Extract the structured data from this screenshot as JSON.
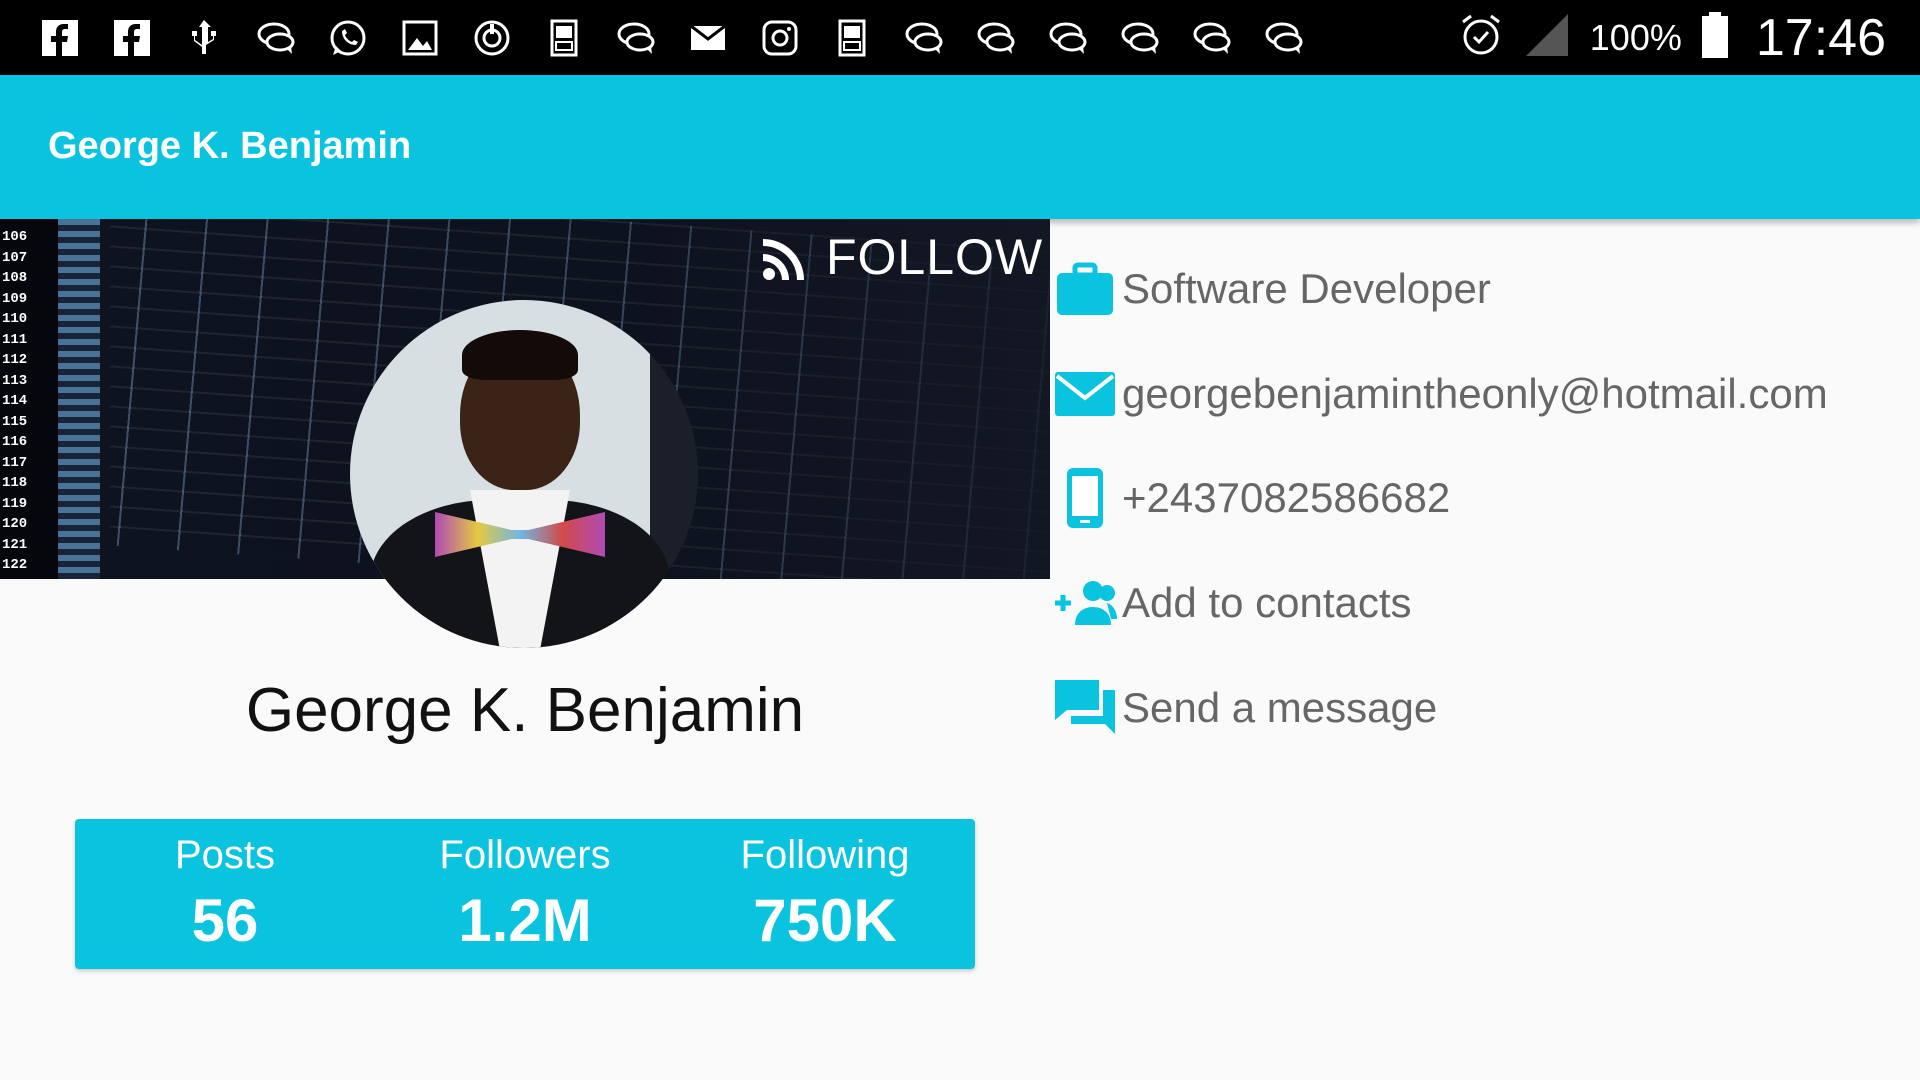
{
  "status_bar": {
    "notification_icons": [
      "facebook-icon",
      "facebook-icon",
      "usb-icon",
      "chat-icon",
      "whatsapp-icon",
      "image-icon",
      "sync-icon",
      "dictionary-icon",
      "chat-icon",
      "mail-icon",
      "instagram-icon",
      "dictionary-icon",
      "chat-icon",
      "chat-icon",
      "chat-icon",
      "chat-icon",
      "chat-icon",
      "chat-icon"
    ],
    "battery_percent": "100%",
    "time": "17:46"
  },
  "app_bar": {
    "title": "George K. Benjamin"
  },
  "cover": {
    "follow_label": "FOLLOW",
    "line_numbers": [
      "106",
      "107",
      "108",
      "109",
      "110",
      "111",
      "112",
      "113",
      "114",
      "115",
      "116",
      "117",
      "118",
      "119",
      "120",
      "121",
      "122"
    ]
  },
  "profile": {
    "name": "George K. Benjamin"
  },
  "stats": {
    "posts_label": "Posts",
    "posts_value": "56",
    "followers_label": "Followers",
    "followers_value": "1.2M",
    "following_label": "Following",
    "following_value": "750K"
  },
  "info": {
    "job": "Software Developer",
    "email": "georgebenjamintheonly@hotmail.com",
    "phone": "+2437082586682",
    "add_contacts": "Add to contacts",
    "send_message": "Send a message"
  },
  "colors": {
    "accent": "#0ac4df",
    "status_bar": "#000000",
    "info_text": "#666666"
  }
}
